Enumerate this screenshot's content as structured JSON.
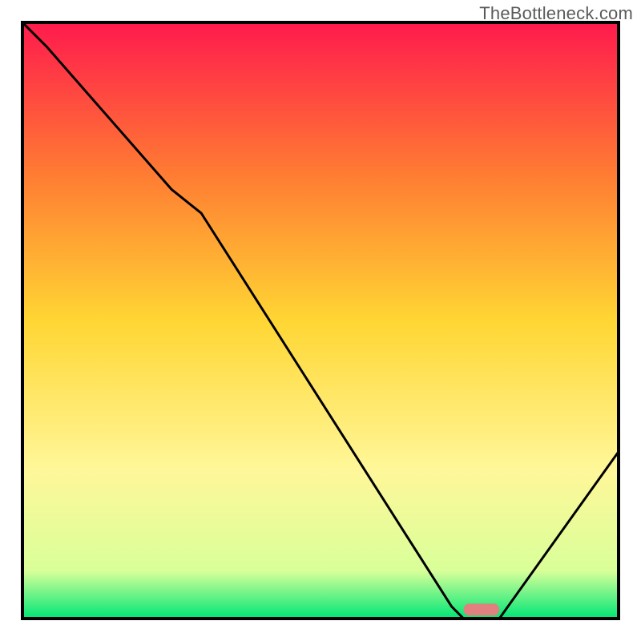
{
  "watermark": {
    "text": "TheBottleneck.com"
  },
  "chart_data": {
    "type": "line",
    "title": "",
    "xlabel": "",
    "ylabel": "",
    "xlim": [
      0,
      100
    ],
    "ylim": [
      0,
      100
    ],
    "grid": false,
    "background": {
      "type": "vertical-gradient",
      "description": "red → orange → yellow → pale-yellow → green",
      "stops": [
        {
          "offset": 0.0,
          "color": "#ff1a4d"
        },
        {
          "offset": 0.25,
          "color": "#ff7a33"
        },
        {
          "offset": 0.5,
          "color": "#ffd633"
        },
        {
          "offset": 0.75,
          "color": "#fff799"
        },
        {
          "offset": 0.92,
          "color": "#d9ff99"
        },
        {
          "offset": 1.0,
          "color": "#00e676"
        }
      ]
    },
    "series": [
      {
        "name": "bottleneck-curve",
        "color": "#000000",
        "x": [
          0,
          4,
          25,
          30,
          72,
          74,
          80,
          100
        ],
        "values": [
          100,
          96,
          72,
          68,
          2,
          0,
          0,
          28
        ]
      }
    ],
    "markers": [
      {
        "name": "optimal-zone",
        "shape": "rounded-bar",
        "color": "#e27f7f",
        "x_start": 74,
        "x_end": 80,
        "y": 1.5,
        "height": 2
      }
    ],
    "frame": {
      "color": "#000000",
      "stroke_width": 4
    }
  }
}
